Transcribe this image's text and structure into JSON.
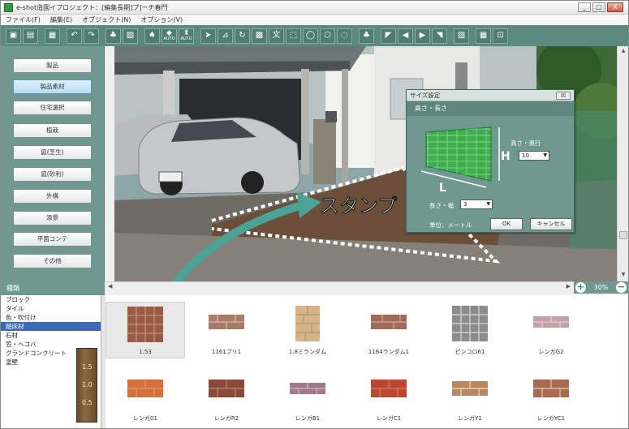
{
  "window": {
    "title": "e-shot造園イプロジェクト：[編集長期]プ]ーチ春門",
    "min": "_",
    "max": "□",
    "close": "X"
  },
  "menu": [
    "ファイル(F)",
    "編集(E)",
    "オブジェクト(N)",
    "オプション(V)"
  ],
  "toolbar": {
    "auto1": "AUTO",
    "auto2": "AUTO",
    "text_tool": "文",
    "colors": {
      "bg": "#5a8a80"
    }
  },
  "left_menu": [
    {
      "label": "製品",
      "active": false
    },
    {
      "label": "製品素材",
      "active": true
    },
    {
      "label": "住宅選択",
      "active": false
    },
    {
      "label": "植栽",
      "active": false
    },
    {
      "label": "庭(芝生)",
      "active": false
    },
    {
      "label": "庭(砂利)",
      "active": false
    },
    {
      "label": "外構",
      "active": false
    },
    {
      "label": "添景",
      "active": false
    },
    {
      "label": "平面コンテ",
      "active": false
    },
    {
      "label": "その他",
      "active": false
    }
  ],
  "overlay": {
    "stamp_text": "スタンプ"
  },
  "dialog": {
    "title": "サイズ設定",
    "close": "☒",
    "section": "高さ・長さ",
    "height_label": "高さ・奥行",
    "height_value": "10",
    "h_letter": "H",
    "l_letter": "L",
    "length_label": "長さ・幅",
    "length_value": "3",
    "unit_label": "単位：メートル",
    "ok": "OK",
    "cancel": "キャンセル"
  },
  "zoom": {
    "value": "30%",
    "plus": "+",
    "minus": "−"
  },
  "category": {
    "header": "種類",
    "items": [
      "ブロック",
      "タイル",
      "色・吹付け",
      "踏床材",
      "石材",
      "笠・ヘコバ",
      "グランドコンクリート",
      "塗壁"
    ],
    "selected_index": 3,
    "ruler_marks": [
      "1.5",
      "1.0",
      "0.5"
    ]
  },
  "materials": [
    {
      "label": "1.53",
      "selected": true
    },
    {
      "label": "1161ブリ1",
      "selected": false
    },
    {
      "label": "1.8ミランダム",
      "selected": false
    },
    {
      "label": "1164ランダム1",
      "selected": false
    },
    {
      "label": "ピンコロ61",
      "selected": false
    },
    {
      "label": "レンガG2",
      "selected": false
    },
    {
      "label": "レンガ01",
      "selected": false
    },
    {
      "label": "レンガR2",
      "selected": false
    },
    {
      "label": "レンガB1",
      "selected": false
    },
    {
      "label": "レンガC1",
      "selected": false
    },
    {
      "label": "レンガY1",
      "selected": false
    },
    {
      "label": "レンガYC1",
      "selected": false
    }
  ]
}
